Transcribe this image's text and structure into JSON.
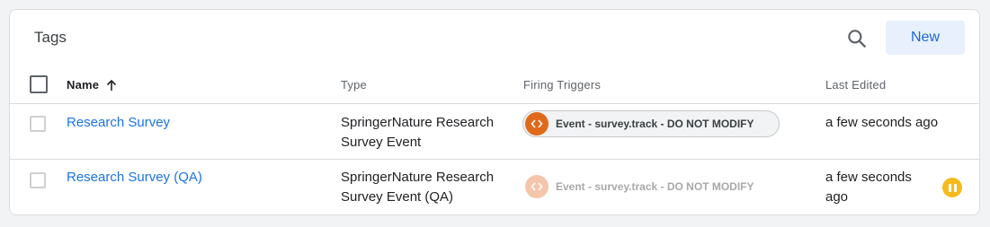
{
  "card": {
    "title": "Tags",
    "new_button_label": "New"
  },
  "columns": {
    "name": "Name",
    "type": "Type",
    "firing_triggers": "Firing Triggers",
    "last_edited": "Last Edited"
  },
  "sort": {
    "column": "Name",
    "direction": "ascending"
  },
  "rows": [
    {
      "name": "Research Survey",
      "type": "SpringerNature Research Survey Event",
      "trigger": "Event - survey.track - DO NOT MODIFY",
      "trigger_enabled": true,
      "last_edited": "a few seconds ago",
      "paused": false
    },
    {
      "name": "Research Survey (QA)",
      "type": "SpringerNature Research Survey Event (QA)",
      "trigger": "Event - survey.track - DO NOT MODIFY",
      "trigger_enabled": false,
      "last_edited": "a few seconds ago",
      "paused": true
    }
  ],
  "icons": {
    "search": "search-icon",
    "sort": "arrow-up-icon",
    "trigger": "code-brackets-icon",
    "paused": "pause-icon"
  },
  "colors": {
    "accent": "#1a73e8",
    "new_button_bg": "#e8f0fe",
    "trigger_icon": "#e0691a",
    "trigger_icon_disabled": "#f4c6ac",
    "paused_badge": "#f5bb1c"
  }
}
